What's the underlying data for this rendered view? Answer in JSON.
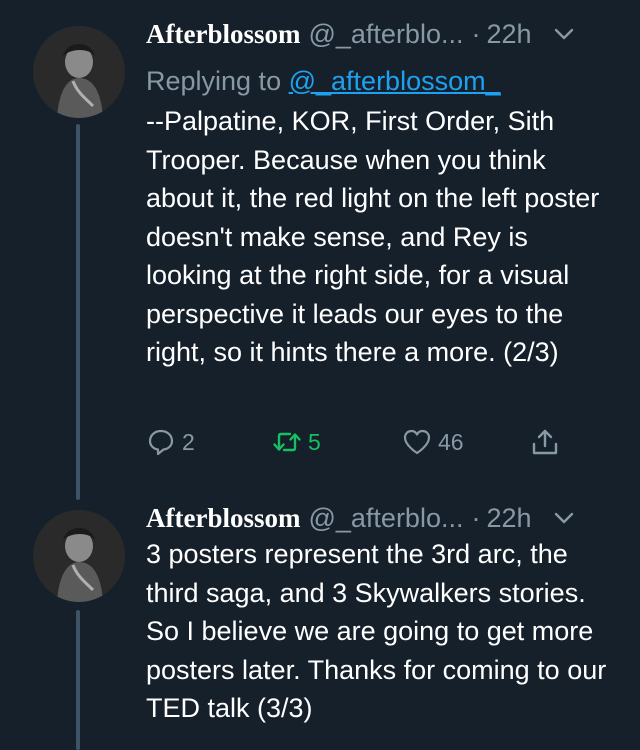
{
  "tweets": [
    {
      "name": "Afterblossom",
      "handle": "@_afterblo...",
      "separator": "·",
      "time": "22h",
      "replying_prefix": "Replying to",
      "replying_to": "@_afterblossom_",
      "text": "--Palpatine, KOR, First Order, Sith Trooper. Because when you think about it, the red light on the left poster doesn't make sense, and Rey is looking at the right side, for a visual perspective it leads our eyes to the right, so it hints there a more. (2/3)",
      "replies": "2",
      "retweets": "5",
      "likes": "46"
    },
    {
      "name": "Afterblossom",
      "handle": "@_afterblo...",
      "separator": "·",
      "time": "22h",
      "text": "3 posters represent the 3rd arc, the third saga, and 3 Skywalkers stories. So I believe we are going to get more posters later. Thanks for coming to our TED talk (3/3)"
    }
  ],
  "colors": {
    "background": "#15202b",
    "secondary_text": "#8899a6",
    "link": "#1da1f2",
    "retweet": "#17bf63",
    "thread_line": "#3d5466"
  }
}
